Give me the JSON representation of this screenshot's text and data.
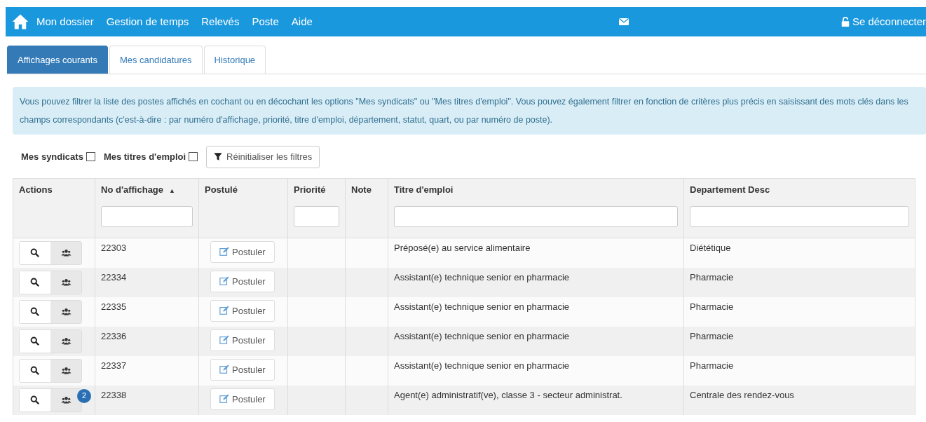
{
  "navbar": {
    "menu": [
      "Mon dossier",
      "Gestion de temps",
      "Relevés",
      "Poste",
      "Aide"
    ],
    "logout": "Se déconnecter"
  },
  "tabs": [
    {
      "label": "Affichages courants",
      "selected": true
    },
    {
      "label": "Mes candidatures",
      "selected": false
    },
    {
      "label": "Historique",
      "selected": false
    }
  ],
  "info": "Vous pouvez filtrer la liste des postes affichés en cochant ou en décochant les options \"Mes syndicats\" ou \"Mes titres d'emploi\". Vous pouvez également filtrer en fonction de critères plus précis en saisissant des mots clés dans les champs correspondants (c'est-à-dire : par numéro d'affichage, priorité, titre d'emploi, département, statut, quart, ou par numéro de poste).",
  "filters": [
    {
      "label": "Mes syndicats",
      "checked": false
    },
    {
      "label": "Mes titres d'emploi",
      "checked": false
    }
  ],
  "reset_button": "Réinitialiser les filtres",
  "table": {
    "columns": [
      {
        "label": "Actions",
        "has_filter": false
      },
      {
        "label": "No d'affichage",
        "sort_indicator": "▲",
        "has_filter": true
      },
      {
        "label": "Postulé",
        "has_filter": false
      },
      {
        "label": "Priorité",
        "has_filter": true
      },
      {
        "label": "Note",
        "has_filter": false
      },
      {
        "label": "Titre d'emploi",
        "has_filter": true
      },
      {
        "label": "Departement Desc",
        "has_filter": true
      }
    ],
    "rows": [
      {
        "number": "22303",
        "apply": "Postuler",
        "title": "Préposé(e) au service alimentaire",
        "department": "Diététique"
      },
      {
        "number": "22334",
        "apply": "Postuler",
        "title": "Assistant(e) technique senior en pharmacie",
        "department": "Pharmacie"
      },
      {
        "number": "22335",
        "apply": "Postuler",
        "title": "Assistant(e) technique senior en pharmacie",
        "department": "Pharmacie"
      },
      {
        "number": "22336",
        "apply": "Postuler",
        "title": "Assistant(e) technique senior en pharmacie",
        "department": "Pharmacie"
      },
      {
        "number": "22337",
        "apply": "Postuler",
        "title": "Assistant(e) technique senior en pharmacie",
        "department": "Pharmacie"
      },
      {
        "number": "22338",
        "apply": "Postuler",
        "title": "Agent(e) administratif(ve), classe 3 - secteur administrat.",
        "department": "Centrale des rendez-vous",
        "badge": "2"
      }
    ]
  }
}
